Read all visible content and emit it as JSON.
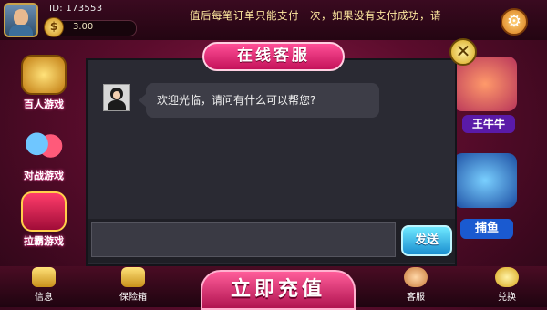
{
  "header": {
    "user_id": "ID: 173553",
    "balance": "3.00",
    "coin_symbol": "$",
    "marquee": "值后每笔订单只能支付一次，如果没有支付成功，请"
  },
  "left_menu": [
    {
      "label": "百人游戏"
    },
    {
      "label": "对战游戏"
    },
    {
      "label": "拉霸游戏"
    }
  ],
  "right_games": [
    {
      "label": "王牛牛"
    },
    {
      "label": "捕鱼"
    }
  ],
  "dialog": {
    "title": "在线客服",
    "close_symbol": "✕",
    "message": "欢迎光临，请问有什么可以帮您?",
    "input_placeholder": "",
    "send_label": "发送"
  },
  "bottom_bar": {
    "messages_label": "信息",
    "safe_label": "保险箱",
    "recharge_label": "立即充值",
    "service_label": "客服",
    "exchange_label": "兑换"
  },
  "colors": {
    "accent_pink": "#ff4f97",
    "send_blue": "#1a8fd0",
    "marquee_text": "#ffe9a0",
    "dialog_bg": "#2a2a33"
  }
}
